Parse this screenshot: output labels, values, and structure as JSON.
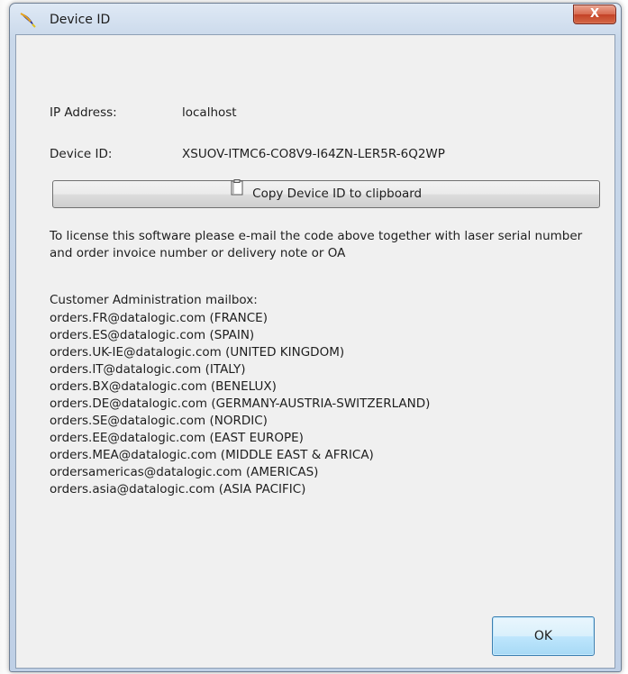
{
  "window": {
    "title": "Device ID",
    "close_glyph": "X"
  },
  "fields": {
    "ip_label": "IP Address:",
    "ip_value": "localhost",
    "device_label": "Device ID:",
    "device_value": "XSUOV-ITMC6-CO8V9-I64ZN-LER5R-6Q2WP"
  },
  "copy_button": {
    "label": "Copy Device ID to clipboard",
    "icon": "clipboard-icon"
  },
  "info_text": "To license this software please e-mail the code above together with laser serial number and order invoice number or delivery note or OA",
  "mailbox": {
    "title": "Customer Administration mailbox:",
    "entries": [
      "orders.FR@datalogic.com (FRANCE)",
      "orders.ES@datalogic.com (SPAIN)",
      "orders.UK-IE@datalogic.com (UNITED KINGDOM)",
      "orders.IT@datalogic.com (ITALY)",
      "orders.BX@datalogic.com (BENELUX)",
      "orders.DE@datalogic.com (GERMANY-AUSTRIA-SWITZERLAND)",
      "orders.SE@datalogic.com (NORDIC)",
      "orders.EE@datalogic.com (EAST EUROPE)",
      "orders.MEA@datalogic.com (MIDDLE EAST & AFRICA)",
      "ordersamericas@datalogic.com (AMERICAS)",
      "orders.asia@datalogic.com (ASIA PACIFIC)"
    ]
  },
  "ok_button": {
    "label": "OK"
  },
  "colors": {
    "client_bg": "#f0f0f0",
    "close_button": "#c34227",
    "ok_border": "#3c7fb1"
  }
}
